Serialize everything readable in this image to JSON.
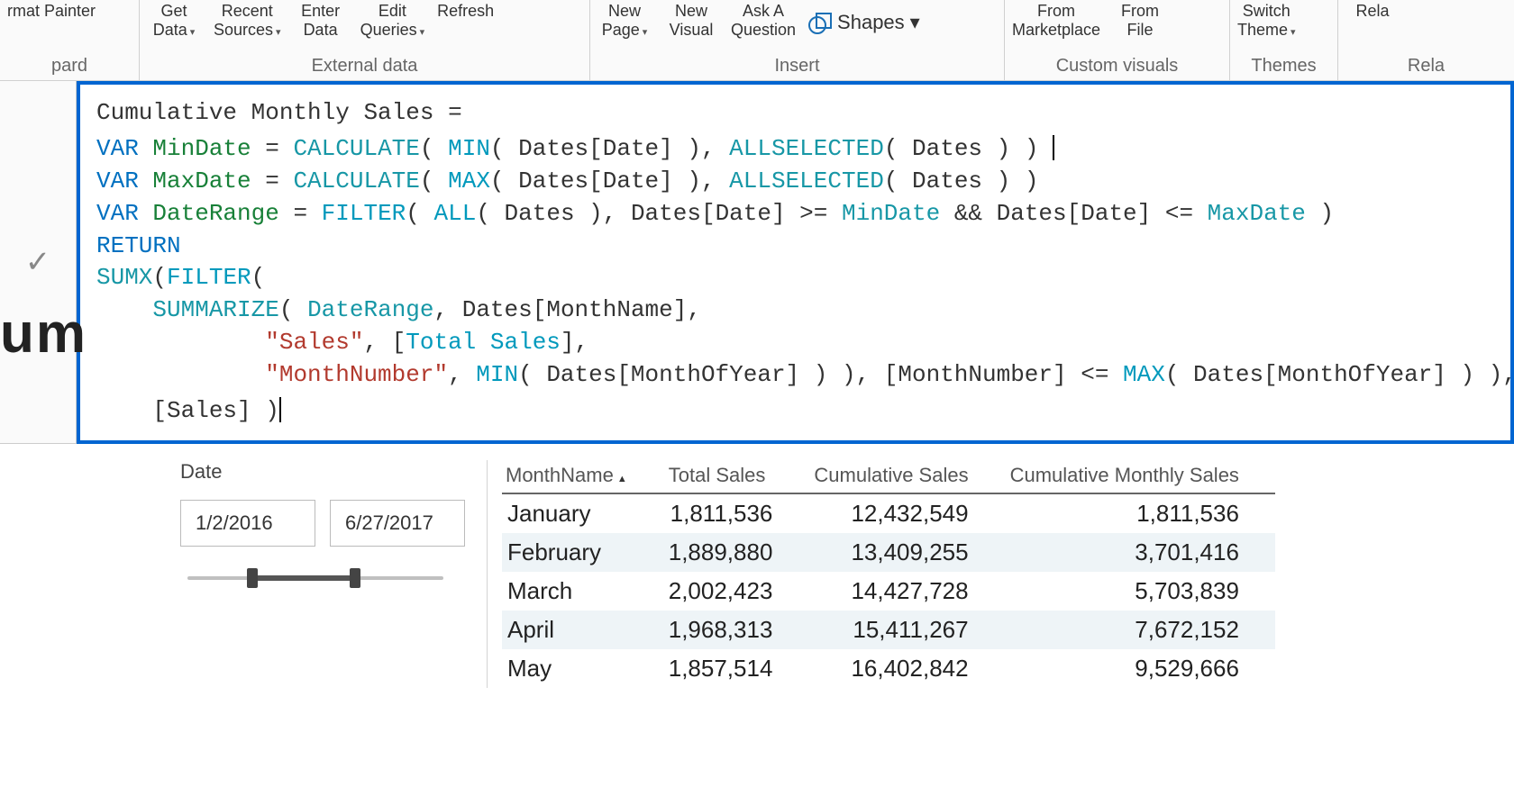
{
  "ribbon": {
    "clipboard": {
      "format_painter_top": "rmat Painter",
      "group_partial": "pard"
    },
    "external_data": {
      "get_data_top": "Get",
      "get_data_bottom": "Data",
      "recent_top": "Recent",
      "recent_bottom": "Sources",
      "enter_top": "Enter",
      "enter_bottom": "Data",
      "edit_top": "Edit",
      "edit_bottom": "Queries",
      "refresh": "Refresh",
      "group": "External data"
    },
    "insert": {
      "new_page_top": "New",
      "new_page_bottom": "Page",
      "new_visual_top": "New",
      "new_visual_bottom": "Visual",
      "ask_top": "Ask A",
      "ask_bottom": "Question",
      "shapes": "Shapes",
      "group": "Insert"
    },
    "custom_visuals": {
      "market_top": "From",
      "market_bottom": "Marketplace",
      "file_top": "From",
      "file_bottom": "File",
      "group": "Custom visuals"
    },
    "themes": {
      "switch_top": "Switch",
      "switch_bottom": "Theme",
      "group": "Themes"
    },
    "relationships": {
      "rel_top": "",
      "rel_bottom": "Rela",
      "group": "Rela"
    }
  },
  "left_clips": {
    "um": "um"
  },
  "formula": {
    "tokens": [
      [
        {
          "c": "plain",
          "t": "Cumulative Monthly Sales = "
        }
      ],
      [
        {
          "c": "kw",
          "t": "VAR "
        },
        {
          "c": "var",
          "t": "MinDate"
        },
        {
          "c": "plain",
          "t": " = "
        },
        {
          "c": "fn",
          "t": "CALCULATE"
        },
        {
          "c": "plain",
          "t": "( "
        },
        {
          "c": "fn2",
          "t": "MIN"
        },
        {
          "c": "plain",
          "t": "( Dates[Date] ), "
        },
        {
          "c": "fn",
          "t": "ALLSELECTED"
        },
        {
          "c": "plain",
          "t": "( Dates ) ) "
        },
        {
          "c": "cursor",
          "t": ""
        }
      ],
      [
        {
          "c": "kw",
          "t": "VAR "
        },
        {
          "c": "var",
          "t": "MaxDate"
        },
        {
          "c": "plain",
          "t": " = "
        },
        {
          "c": "fn",
          "t": "CALCULATE"
        },
        {
          "c": "plain",
          "t": "( "
        },
        {
          "c": "fn2",
          "t": "MAX"
        },
        {
          "c": "plain",
          "t": "( Dates[Date] ), "
        },
        {
          "c": "fn",
          "t": "ALLSELECTED"
        },
        {
          "c": "plain",
          "t": "( Dates ) )"
        }
      ],
      [
        {
          "c": "kw",
          "t": "VAR "
        },
        {
          "c": "var",
          "t": "DateRange"
        },
        {
          "c": "plain",
          "t": " = "
        },
        {
          "c": "fn2",
          "t": "FILTER"
        },
        {
          "c": "plain",
          "t": "( "
        },
        {
          "c": "fn2",
          "t": "ALL"
        },
        {
          "c": "plain",
          "t": "( Dates ), Dates[Date] >= "
        },
        {
          "c": "usevar",
          "t": "MinDate"
        },
        {
          "c": "plain",
          "t": " && Dates[Date] <= "
        },
        {
          "c": "usevar",
          "t": "MaxDate"
        },
        {
          "c": "plain",
          "t": " )"
        }
      ],
      [
        {
          "c": "plain",
          "t": ""
        }
      ],
      [
        {
          "c": "kw",
          "t": "RETURN"
        }
      ],
      [
        {
          "c": "fn",
          "t": "SUMX"
        },
        {
          "c": "plain",
          "t": "("
        },
        {
          "c": "fn2",
          "t": "FILTER"
        },
        {
          "c": "plain",
          "t": "("
        }
      ],
      [
        {
          "c": "plain",
          "t": "    "
        },
        {
          "c": "fn",
          "t": "SUMMARIZE"
        },
        {
          "c": "plain",
          "t": "( "
        },
        {
          "c": "usevar",
          "t": "DateRange"
        },
        {
          "c": "plain",
          "t": ", Dates[MonthName],"
        }
      ],
      [
        {
          "c": "plain",
          "t": "            "
        },
        {
          "c": "str",
          "t": "\"Sales\""
        },
        {
          "c": "plain",
          "t": ", ["
        },
        {
          "c": "fn2",
          "t": "Total Sales"
        },
        {
          "c": "plain",
          "t": "],"
        }
      ],
      [
        {
          "c": "plain",
          "t": "            "
        },
        {
          "c": "str",
          "t": "\"MonthNumber\""
        },
        {
          "c": "plain",
          "t": ", "
        },
        {
          "c": "fn2",
          "t": "MIN"
        },
        {
          "c": "plain",
          "t": "( Dates[MonthOfYear] ) ), [MonthNumber] <= "
        },
        {
          "c": "fn2",
          "t": "MAX"
        },
        {
          "c": "plain",
          "t": "( Dates[MonthOfYear] ) ),"
        }
      ],
      [
        {
          "c": "plain",
          "t": "    [Sales] )"
        },
        {
          "c": "cursor",
          "t": ""
        }
      ]
    ]
  },
  "slicer": {
    "title": "Date",
    "from": "1/2/2016",
    "to": "6/27/2017"
  },
  "table": {
    "columns": [
      "MonthName",
      "Total Sales",
      "Cumulative Sales",
      "Cumulative Monthly Sales"
    ],
    "rows": [
      {
        "month": "January",
        "total": "1,811,536",
        "cum": "12,432,549",
        "cms": "1,811,536"
      },
      {
        "month": "February",
        "total": "1,889,880",
        "cum": "13,409,255",
        "cms": "3,701,416"
      },
      {
        "month": "March",
        "total": "2,002,423",
        "cum": "14,427,728",
        "cms": "5,703,839"
      },
      {
        "month": "April",
        "total": "1,968,313",
        "cum": "15,411,267",
        "cms": "7,672,152"
      },
      {
        "month": "May",
        "total": "1,857,514",
        "cum": "16,402,842",
        "cms": "9,529,666"
      }
    ]
  }
}
